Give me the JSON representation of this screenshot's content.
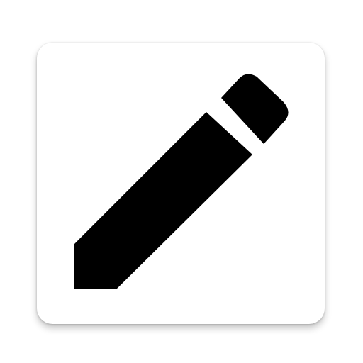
{
  "icon": {
    "name": "pencil-icon",
    "background_color": "#ffffff",
    "glyph_color": "#000000"
  }
}
